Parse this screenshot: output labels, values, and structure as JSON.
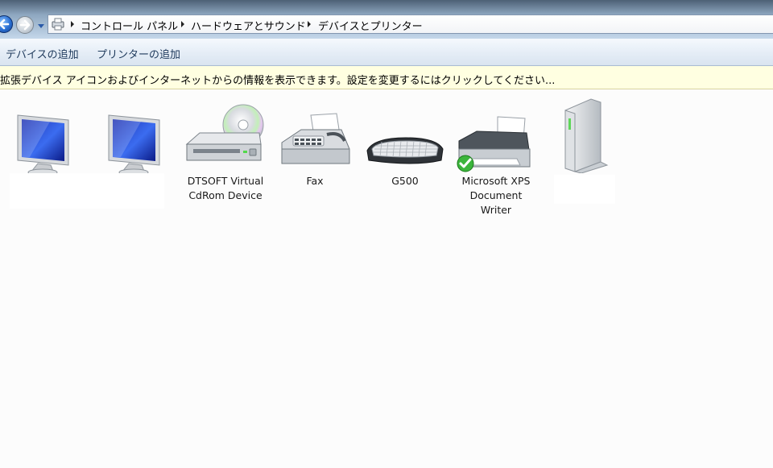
{
  "navigation": {
    "breadcrumbs": [
      "コントロール パネル",
      "ハードウェアとサウンド",
      "デバイスとプリンター"
    ]
  },
  "toolbar": {
    "add_device": "デバイスの追加",
    "add_printer": "プリンターの追加"
  },
  "infobar": {
    "message": "拡張デバイス アイコンおよびインターネットからの情報を表示できます。設定を変更するにはクリックしてください..."
  },
  "devices": [
    {
      "label": "",
      "icon": "monitor-icon"
    },
    {
      "label": "",
      "icon": "monitor-icon"
    },
    {
      "label": "DTSOFT Virtual\nCdRom Device",
      "icon": "cd-drive-icon"
    },
    {
      "label": "Fax",
      "icon": "fax-icon"
    },
    {
      "label": "G500",
      "icon": "keyboard-icon"
    },
    {
      "label": "Microsoft XPS\nDocument\nWriter",
      "icon": "printer-icon"
    },
    {
      "label": "",
      "icon": "external-drive-icon"
    }
  ]
}
